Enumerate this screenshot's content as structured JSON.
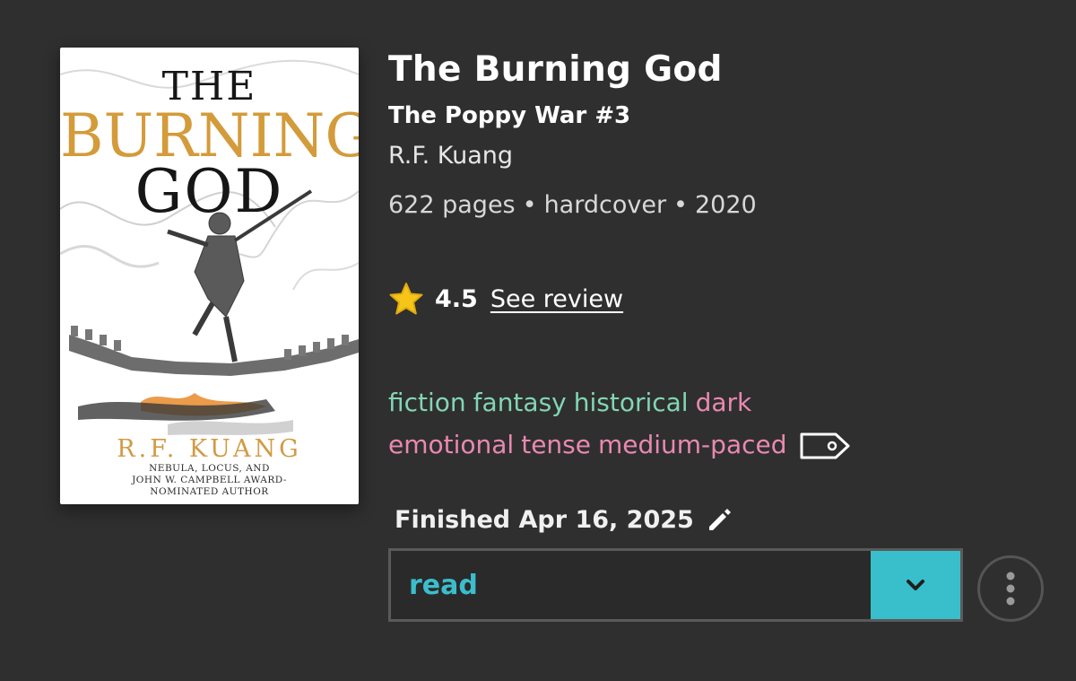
{
  "book": {
    "title": "The Burning God",
    "series": "The Poppy War #3",
    "author": "R.F. Kuang",
    "pages": "622 pages",
    "format": "hardcover",
    "year": "2020",
    "separator": "•"
  },
  "cover": {
    "title_line1": "THE",
    "title_line2": "BURNING",
    "title_line3": "GOD",
    "author": "R.F. KUANG",
    "blurb_line1": "NEBULA, LOCUS, AND",
    "blurb_line2": "JOHN W. CAMPBELL AWARD-",
    "blurb_line3": "NOMINATED AUTHOR",
    "title_gold_color": "#d39b3a"
  },
  "rating": {
    "icon": "star-icon",
    "value": "4.5",
    "review_link": "See review",
    "star_color": "#f5c518"
  },
  "tags": {
    "genres": [
      "fiction",
      "fantasy",
      "historical"
    ],
    "moods": [
      "dark",
      "emotional",
      "tense",
      "medium-paced"
    ],
    "genre_color": "#82d6b4",
    "mood_color": "#e989b0",
    "edit_icon": "tag-icon"
  },
  "reading": {
    "finished_label": "Finished Apr 16, 2025",
    "edit_icon": "pencil-icon",
    "status": "read",
    "status_toggle_icon": "chevron-down-icon",
    "accent_color": "#38bfcb",
    "more_icon": "more-icon"
  }
}
